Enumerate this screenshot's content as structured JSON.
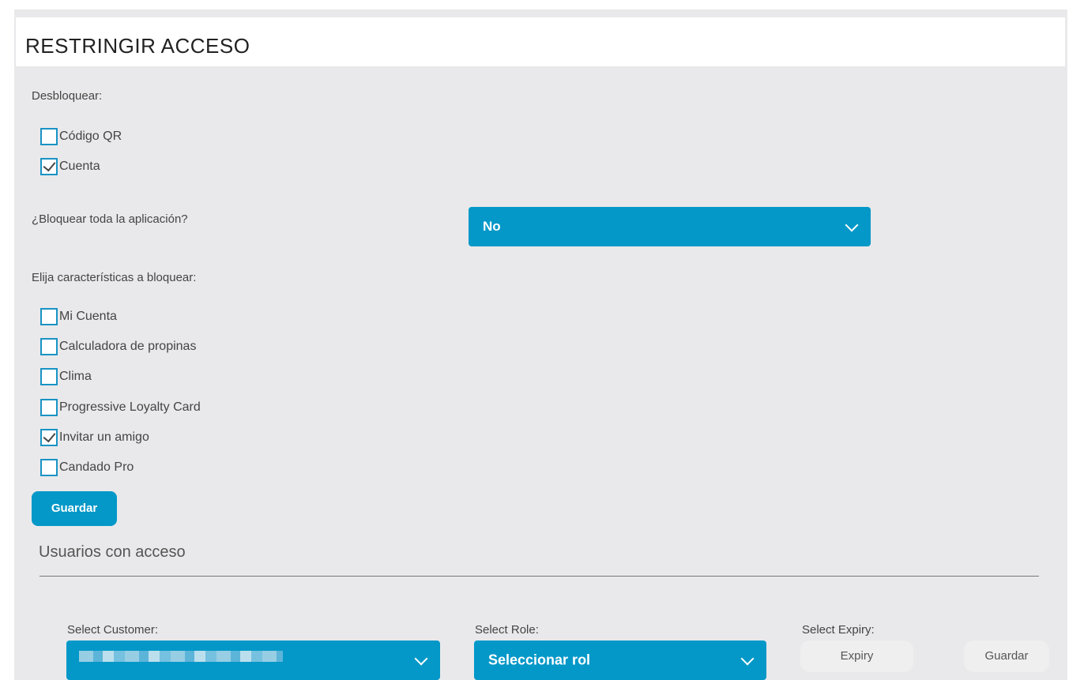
{
  "header": {
    "title": "RESTRINGIR ACCESO"
  },
  "unlock": {
    "label": "Desbloquear:",
    "options": [
      {
        "label": "Código QR",
        "checked": false
      },
      {
        "label": "Cuenta",
        "checked": true
      }
    ]
  },
  "block_app": {
    "label": "¿Bloquear toda la aplicación?",
    "selected": "No"
  },
  "features": {
    "label": "Elija características a bloquear:",
    "options": [
      {
        "label": "Mi Cuenta",
        "checked": false
      },
      {
        "label": "Calculadora de propinas",
        "checked": false
      },
      {
        "label": "Clima",
        "checked": false
      },
      {
        "label": "Progressive Loyalty Card",
        "checked": false
      },
      {
        "label": "Invitar un amigo",
        "checked": true
      },
      {
        "label": "Candado Pro",
        "checked": false
      }
    ],
    "save_label": "Guardar"
  },
  "access": {
    "title": "Usuarios con acceso",
    "customer_label": "Select Customer:",
    "role_label": "Select Role:",
    "role_selected": "Seleccionar rol",
    "expiry_label": "Select Expiry:",
    "expiry_placeholder": "Expiry",
    "save_label": "Guardar"
  },
  "colors": {
    "accent": "#0398c8",
    "checkbox_border": "#1993c4",
    "panel_bg": "#e9e9eb"
  }
}
